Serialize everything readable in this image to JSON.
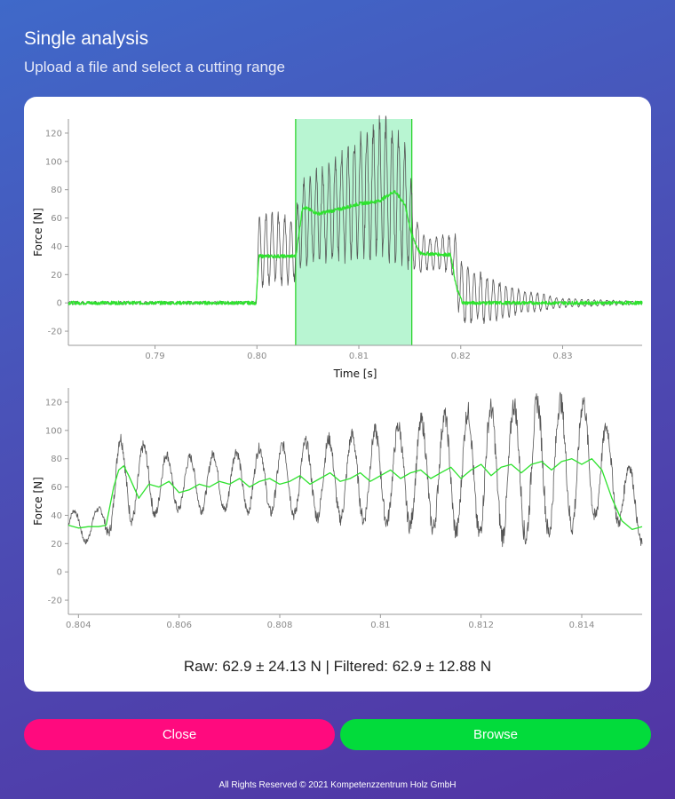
{
  "header": {
    "title": "Single analysis",
    "subtitle": "Upload a file and select a cutting range"
  },
  "chart_data": [
    {
      "type": "line",
      "xlabel": "Time [s]",
      "ylabel": "Force [N]",
      "xlim": [
        0.7815,
        0.8378
      ],
      "ylim": [
        -30,
        130
      ],
      "xticks": [
        "0.79",
        "0.80",
        "0.81",
        "0.82",
        "0.83"
      ],
      "xtick_values": [
        0.79,
        0.8,
        0.81,
        0.82,
        0.83
      ],
      "yticks": [
        -20,
        0,
        20,
        40,
        60,
        80,
        100,
        120
      ],
      "selection_range": [
        0.8038,
        0.8152
      ],
      "grid": false,
      "series": [
        {
          "color": "#555555",
          "description": "raw oscillating force",
          "x": [
            0.7815,
            0.79,
            0.7999,
            0.8,
            0.8002,
            0.8038,
            0.8042,
            0.807,
            0.81,
            0.8125,
            0.8145,
            0.8152,
            0.816,
            0.819,
            0.8195,
            0.82,
            0.823,
            0.826,
            0.83,
            0.8378
          ],
          "y": [
            0,
            0,
            0,
            30,
            38,
            38,
            55,
            65,
            75,
            82,
            70,
            52,
            35,
            35,
            28,
            8,
            2,
            1,
            0,
            0
          ],
          "amplitude": [
            1,
            1,
            1,
            25,
            25,
            22,
            28,
            32,
            40,
            48,
            40,
            30,
            12,
            12,
            18,
            22,
            14,
            8,
            3,
            1
          ]
        },
        {
          "color": "#2ee22e",
          "description": "filtered force",
          "x": [
            0.7815,
            0.7999,
            0.8002,
            0.8038,
            0.8045,
            0.806,
            0.808,
            0.81,
            0.812,
            0.8135,
            0.8145,
            0.8152,
            0.816,
            0.819,
            0.8196,
            0.8202,
            0.8378
          ],
          "y": [
            0,
            0,
            33,
            33,
            68,
            63,
            66,
            70,
            72,
            79,
            70,
            48,
            35,
            34,
            10,
            0,
            0
          ]
        }
      ]
    },
    {
      "type": "line",
      "xlabel": "",
      "ylabel": "Force [N]",
      "xlim": [
        0.8038,
        0.8152
      ],
      "ylim": [
        -30,
        130
      ],
      "xticks": [
        "0.804",
        "0.806",
        "0.808",
        "0.81",
        "0.812",
        "0.814"
      ],
      "xtick_values": [
        0.804,
        0.806,
        0.808,
        0.81,
        0.812,
        0.814
      ],
      "yticks": [
        -20,
        0,
        20,
        40,
        60,
        80,
        100,
        120
      ],
      "grid": false,
      "series": [
        {
          "color": "#555555",
          "description": "raw force (zoomed)",
          "x": [
            0.8038,
            0.8044,
            0.8048,
            0.806,
            0.8075,
            0.809,
            0.81,
            0.8115,
            0.813,
            0.814,
            0.8145,
            0.8152
          ],
          "y": [
            33,
            32,
            65,
            62,
            65,
            66,
            68,
            70,
            72,
            78,
            72,
            40
          ],
          "amplitude": [
            10,
            12,
            30,
            18,
            22,
            28,
            32,
            42,
            48,
            44,
            30,
            20
          ]
        },
        {
          "color": "#2ee22e",
          "description": "filtered force (zoomed)",
          "x": [
            0.8038,
            0.804,
            0.8042,
            0.8044,
            0.80455,
            0.8047,
            0.8048,
            0.8049,
            0.805,
            0.8052,
            0.8054,
            0.8056,
            0.8058,
            0.806,
            0.8062,
            0.8064,
            0.8066,
            0.8068,
            0.807,
            0.8072,
            0.8074,
            0.8076,
            0.8078,
            0.808,
            0.8082,
            0.8084,
            0.8086,
            0.8088,
            0.809,
            0.8092,
            0.8094,
            0.8096,
            0.8098,
            0.81,
            0.8102,
            0.8104,
            0.8106,
            0.8108,
            0.811,
            0.8112,
            0.8114,
            0.8116,
            0.8118,
            0.812,
            0.8122,
            0.8124,
            0.8126,
            0.8128,
            0.813,
            0.8132,
            0.8134,
            0.8136,
            0.8138,
            0.814,
            0.8142,
            0.8144,
            0.8146,
            0.8148,
            0.815,
            0.8152
          ],
          "y": [
            33,
            31,
            32,
            32,
            33,
            60,
            72,
            75,
            68,
            52,
            62,
            60,
            64,
            56,
            58,
            62,
            60,
            64,
            62,
            66,
            60,
            64,
            66,
            62,
            64,
            68,
            62,
            66,
            70,
            64,
            66,
            70,
            64,
            68,
            72,
            66,
            70,
            72,
            66,
            70,
            74,
            66,
            72,
            76,
            68,
            74,
            76,
            70,
            76,
            78,
            72,
            78,
            80,
            76,
            80,
            72,
            52,
            36,
            30,
            32
          ]
        }
      ]
    }
  ],
  "stats": {
    "text": "Raw: 62.9 ± 24.13 N | Filtered: 62.9 ± 12.88 N"
  },
  "buttons": {
    "close_label": "Close",
    "browse_label": "Browse"
  },
  "footer": {
    "text": "All Rights Reserved © 2021 Kompetenzzentrum Holz GmbH"
  },
  "colors": {
    "close_button": "#ff0a7e",
    "browse_button": "#02db3b",
    "selection_fill": "#b8f5d2",
    "selection_border": "#1ed11e"
  }
}
